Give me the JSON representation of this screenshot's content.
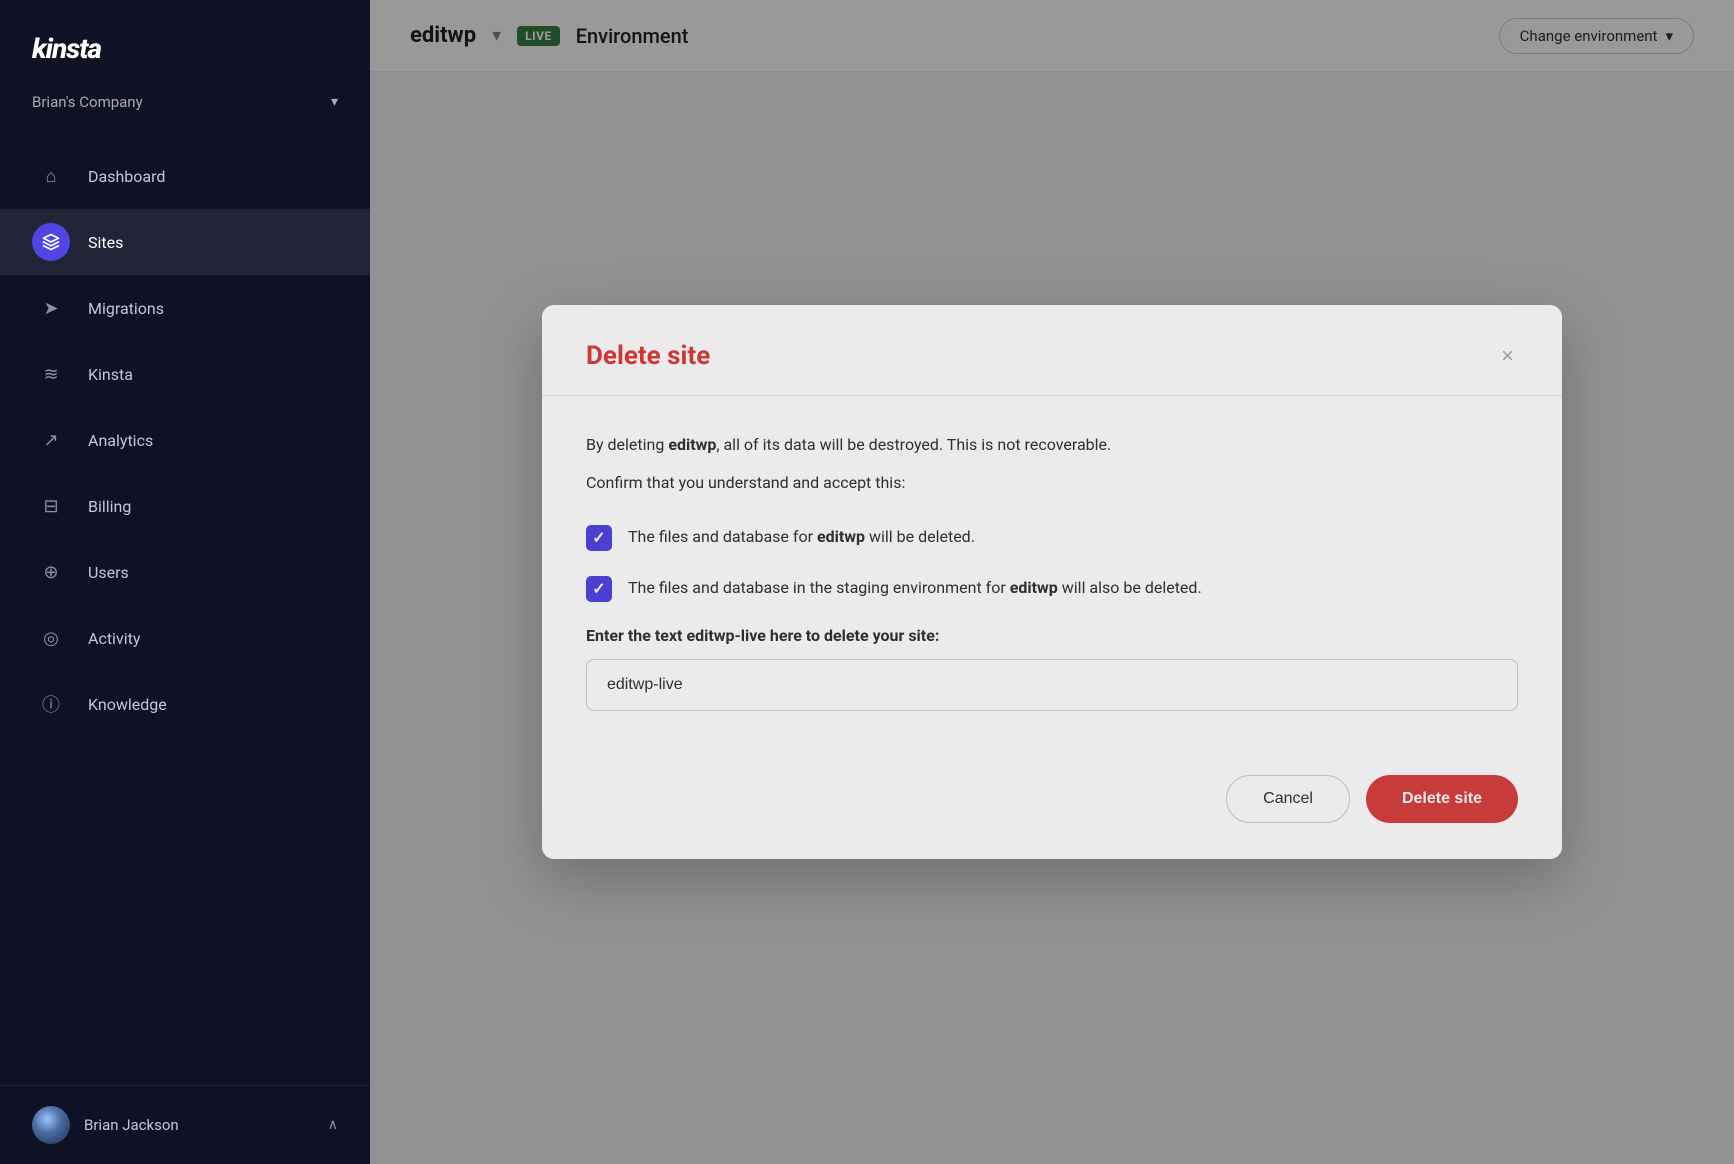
{
  "sidebar": {
    "logo": "kinsta",
    "company": "Brian's Company",
    "company_chevron": "▾",
    "nav_items": [
      {
        "id": "dashboard",
        "label": "Dashboard",
        "icon": "⌂",
        "active": false
      },
      {
        "id": "sites",
        "label": "Sites",
        "icon": "◈",
        "active": true
      },
      {
        "id": "migrations",
        "label": "Migrations",
        "icon": "➤",
        "active": false
      },
      {
        "id": "kinsta-intelligence",
        "label": "Kinsta",
        "icon": "≋",
        "active": false
      },
      {
        "id": "analytics",
        "label": "Analytics",
        "icon": "↗",
        "active": false
      },
      {
        "id": "billing",
        "label": "Billing",
        "icon": "⊟",
        "active": false
      },
      {
        "id": "users",
        "label": "Users",
        "icon": "⊕",
        "active": false
      },
      {
        "id": "activity",
        "label": "Activity",
        "icon": "◎",
        "active": false
      },
      {
        "id": "knowledge",
        "label": "Knowledge",
        "icon": "ⓘ",
        "active": false
      }
    ],
    "user": {
      "name": "Brian Jackson",
      "chevron": "∧"
    }
  },
  "header": {
    "site_name": "editwp",
    "chevron": "▾",
    "live_badge": "LIVE",
    "env_label": "Environment",
    "change_env_label": "Change environment",
    "change_env_chevron": "▾"
  },
  "modal": {
    "title": "Delete site",
    "close_label": "×",
    "description_prefix": "By deleting ",
    "description_site": "editwp",
    "description_suffix": ", all of its data will be destroyed. This is not recoverable.",
    "confirm_prompt": "Confirm that you understand and accept this:",
    "checkbox1_prefix": "The files and database for ",
    "checkbox1_site": "editwp",
    "checkbox1_suffix": " will be deleted.",
    "checkbox1_checked": true,
    "checkbox2_prefix": "The files and database in the staging environment for ",
    "checkbox2_site": "editwp",
    "checkbox2_suffix": " will also be deleted.",
    "checkbox2_checked": true,
    "input_label": "Enter the text editwp-live here to delete your site:",
    "input_value": "editwp-live",
    "input_placeholder": "editwp-live",
    "cancel_label": "Cancel",
    "delete_label": "Delete site"
  }
}
